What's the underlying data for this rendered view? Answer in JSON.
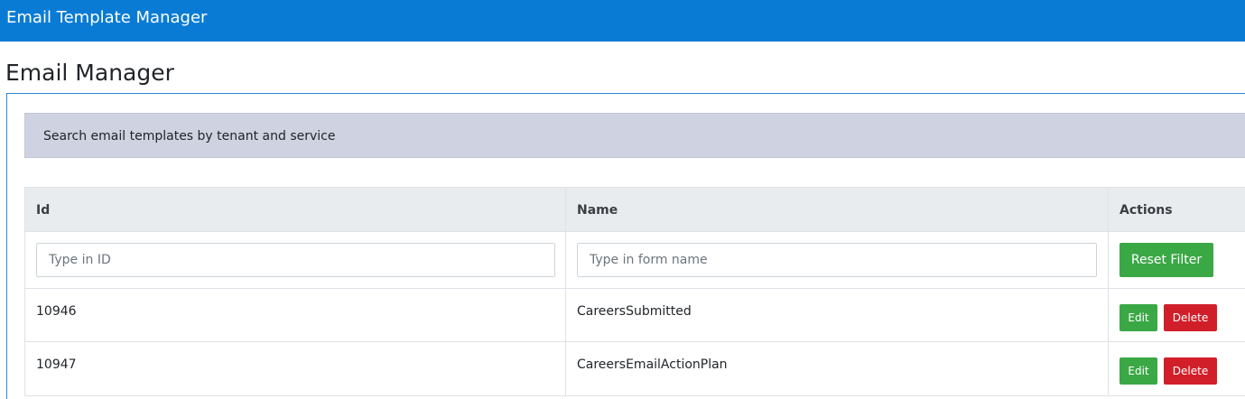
{
  "header": {
    "app_title": "Email Template Manager"
  },
  "page": {
    "title": "Email Manager"
  },
  "search_banner": {
    "text": "Search email templates by tenant and service"
  },
  "table": {
    "columns": [
      "Id",
      "Name",
      "Actions"
    ],
    "filters": {
      "id_placeholder": "Type in ID",
      "name_placeholder": "Type in form name",
      "id_value": "",
      "name_value": "",
      "reset_label": "Reset Filter"
    },
    "rows": [
      {
        "id": "10946",
        "name": "CareersSubmitted",
        "edit_label": "Edit",
        "delete_label": "Delete"
      },
      {
        "id": "10947",
        "name": "CareersEmailActionPlan",
        "edit_label": "Edit",
        "delete_label": "Delete"
      }
    ]
  },
  "colors": {
    "header_bg": "#0a7bd4",
    "banner_bg": "#cfd2e0",
    "success": "#3aa845",
    "danger": "#d11f2a"
  }
}
